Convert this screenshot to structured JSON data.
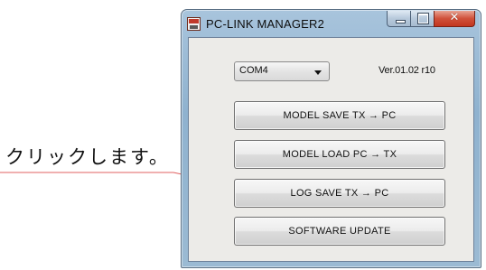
{
  "callout": {
    "text": "クリックします。"
  },
  "window": {
    "title": "PC-LINK MANAGER2",
    "controls": {
      "close_glyph": "✕"
    }
  },
  "port_select": {
    "value": "COM4"
  },
  "version": "Ver.01.02 r10",
  "buttons": {
    "model_save": "MODEL SAVE TX → PC",
    "model_load": "MODEL LOAD PC → TX",
    "log_save": "LOG SAVE TX → PC",
    "software_update": "SOFTWARE UPDATE"
  },
  "colors": {
    "callout_line": "#e06060",
    "close_button": "#c2361f",
    "window_frame": "#9bbad3"
  }
}
